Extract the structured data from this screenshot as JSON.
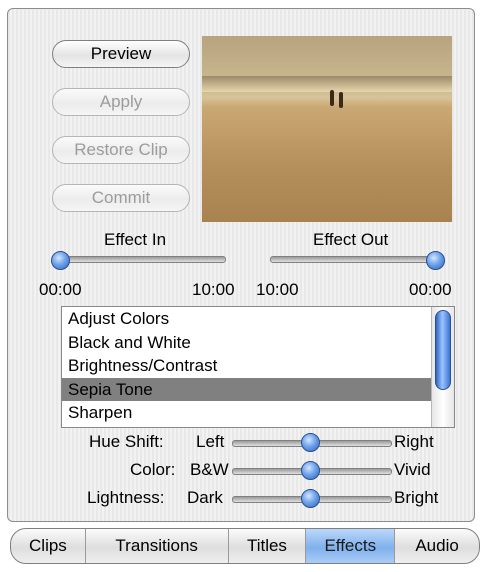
{
  "buttons": {
    "preview": "Preview",
    "apply": "Apply",
    "restore_clip": "Restore Clip",
    "commit": "Commit"
  },
  "effect_in": {
    "label": "Effect In",
    "start_time": "00:00",
    "end_time": "10:00",
    "position": 0.0
  },
  "effect_out": {
    "label": "Effect Out",
    "start_time": "10:00",
    "end_time": "00:00",
    "position": 1.0
  },
  "effects_list": {
    "items": [
      "Adjust Colors",
      "Black and White",
      "Brightness/Contrast",
      "Sepia Tone",
      "Sharpen"
    ],
    "selected": "Sepia Tone"
  },
  "adjustments": {
    "hue_shift": {
      "label": "Hue Shift:",
      "left": "Left",
      "right": "Right",
      "value": 0.5
    },
    "color": {
      "label": "Color:",
      "left": "B&W",
      "right": "Vivid",
      "value": 0.5
    },
    "lightness": {
      "label": "Lightness:",
      "left": "Dark",
      "right": "Bright",
      "value": 0.5
    }
  },
  "tabs": [
    "Clips",
    "Transitions",
    "Titles",
    "Effects",
    "Audio"
  ],
  "active_tab": "Effects",
  "colors": {
    "accent": "#2f64bd",
    "selected_row": "#808080",
    "active_tab": "#80b0ec"
  }
}
